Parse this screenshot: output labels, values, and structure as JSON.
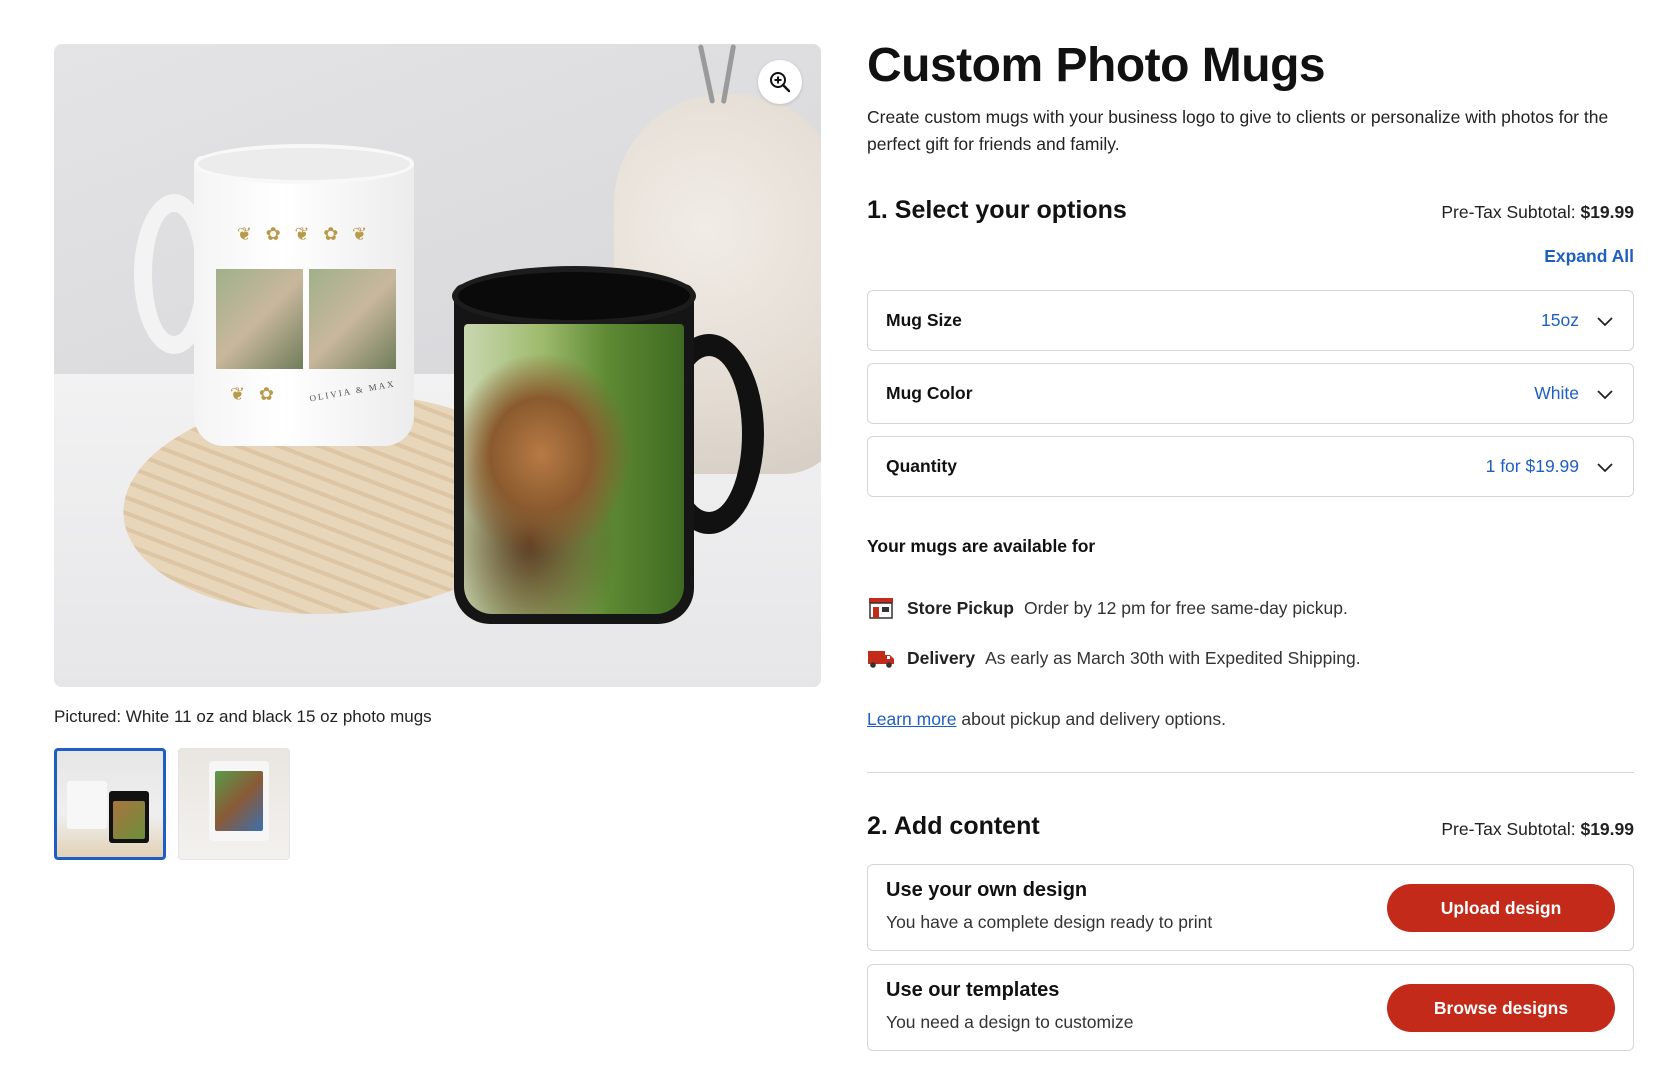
{
  "product": {
    "title": "Custom Photo Mugs",
    "description": "Create custom mugs with your business logo to give to clients or personalize with photos for the perfect gift for friends and family.",
    "image_caption": "Pictured: White 11 oz and black 15 oz photo mugs",
    "mug_print_text": "OLIVIA & MAX",
    "zoom_icon": "zoom-in-icon"
  },
  "thumbnails": [
    {
      "name": "thumbnail-mugs-dog",
      "active": true
    },
    {
      "name": "thumbnail-mug-family",
      "active": false
    }
  ],
  "options": {
    "heading": "1. Select your options",
    "subtotal_label": "Pre-Tax Subtotal:",
    "subtotal_value": "$19.99",
    "expand_all": "Expand All",
    "rows": [
      {
        "label": "Mug Size",
        "value": "15oz"
      },
      {
        "label": "Mug Color",
        "value": "White"
      },
      {
        "label": "Quantity",
        "value": "1 for $19.99"
      }
    ]
  },
  "availability": {
    "title": "Your mugs are available for",
    "pickup": {
      "name": "Store Pickup",
      "detail": "Order by 12 pm for free same-day pickup.",
      "icon": "store-icon"
    },
    "delivery": {
      "name": "Delivery",
      "detail": "As early as March 30th with Expedited Shipping.",
      "icon": "truck-icon"
    },
    "learn_more_link": "Learn more",
    "learn_more_rest": "about pickup and delivery options."
  },
  "content": {
    "heading": "2. Add content",
    "subtotal_label": "Pre-Tax Subtotal:",
    "subtotal_value": "$19.99",
    "cards": [
      {
        "title": "Use your own design",
        "subtitle": "You have a complete design ready to print",
        "button": "Upload design"
      },
      {
        "title": "Use our templates",
        "subtitle": "You need a design to customize",
        "button": "Browse designs"
      }
    ]
  },
  "colors": {
    "accent_blue": "#1f5fc4",
    "button_red": "#c42a1a",
    "border": "#d6d6d6"
  }
}
